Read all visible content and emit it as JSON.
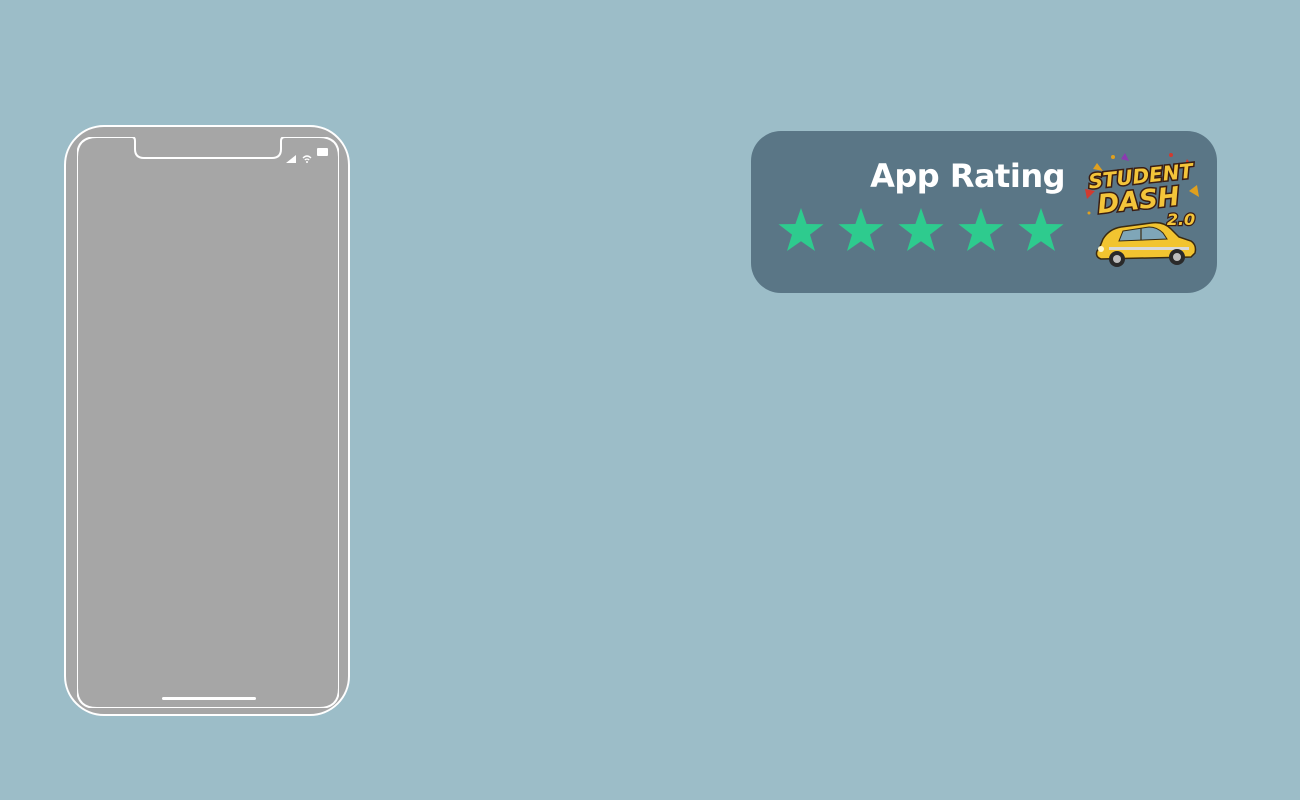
{
  "rating_card": {
    "title": "App Rating",
    "rating": 5,
    "max_rating": 5,
    "star_color": "#2ecb8e",
    "card_color": "#5a7686",
    "logo": {
      "line1": "STUDENT",
      "line2": "DASH",
      "version": "2.0",
      "icon": "taxi-car-icon"
    }
  },
  "phone": {
    "screen_color": "#a6a6a6",
    "frame_color": "#ffffff",
    "status_icons": [
      "signal-icon",
      "wifi-icon",
      "battery-icon"
    ]
  },
  "background_color": "#9cbdc8"
}
